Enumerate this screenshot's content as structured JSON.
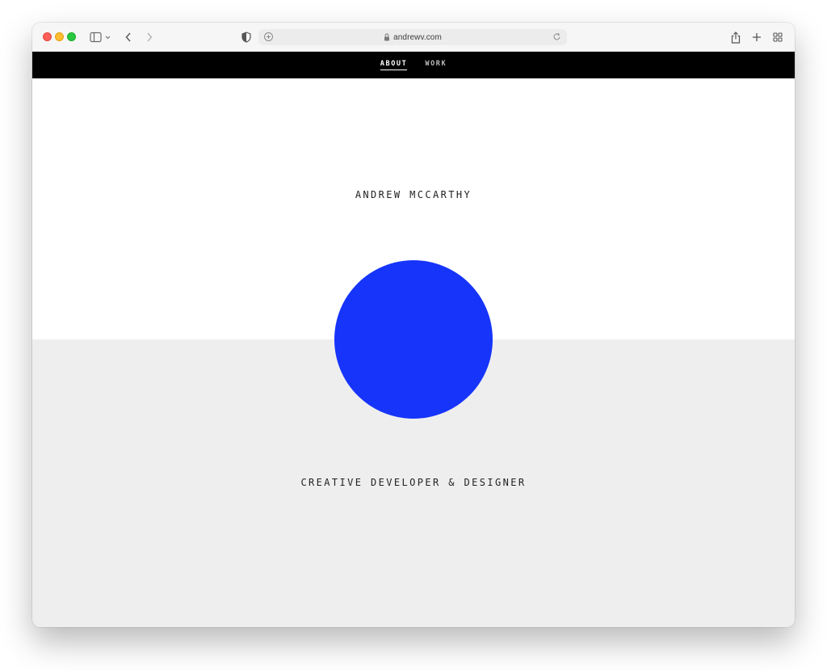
{
  "browser": {
    "url": "andrewv.com",
    "icons": {
      "sidebar": "sidebar-icon",
      "back": "chevron-left-icon",
      "forward": "chevron-right-icon",
      "privacy": "shield-icon",
      "reader": "reader-icon",
      "lock": "lock-icon",
      "reload": "reload-icon",
      "share": "share-icon",
      "new_tab": "plus-icon",
      "tab_overview": "tab-overview-icon"
    }
  },
  "nav": {
    "items": [
      {
        "label": "ABOUT",
        "active": true
      },
      {
        "label": "WORK",
        "active": false
      }
    ]
  },
  "hero": {
    "name": "ANDREW MCCARTHY",
    "tagline": "CREATIVE DEVELOPER & DESIGNER",
    "circle_color": "#1634fa"
  },
  "colors": {
    "nav_background": "#000000",
    "top_background": "#ffffff",
    "bottom_background": "#eeeeef",
    "accent": "#1634fa"
  }
}
